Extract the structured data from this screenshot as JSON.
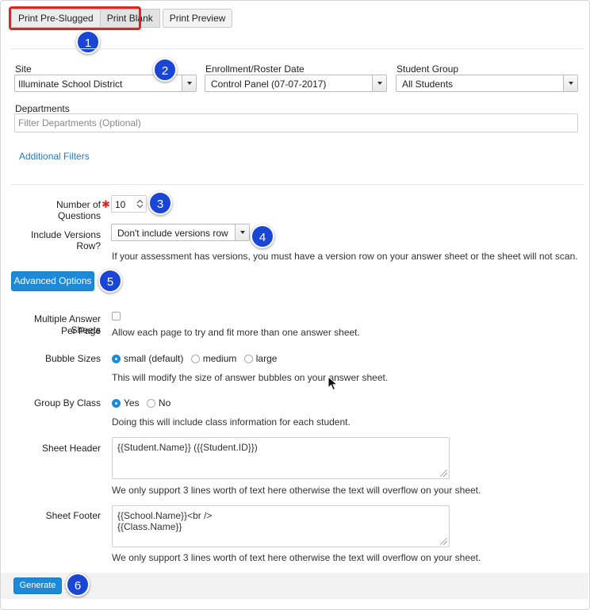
{
  "tabs": {
    "print_pre_slugged": "Print Pre-Slugged",
    "print_blank": "Print Blank",
    "print_preview": "Print Preview"
  },
  "badges": [
    "1",
    "2",
    "3",
    "4",
    "5",
    "6"
  ],
  "filters": {
    "site_label": "Site",
    "site_value": "Illuminate School District",
    "enrollment_label": "Enrollment/Roster Date",
    "enrollment_value": "Control Panel (07-07-2017)",
    "student_group_label": "Student Group",
    "student_group_value": "All Students",
    "departments_label": "Departments",
    "departments_placeholder": "Filter Departments (Optional)",
    "additional_filters": "Additional Filters"
  },
  "form": {
    "num_questions_label": "Number of Questions",
    "num_questions_required": "✱",
    "num_questions_value": "10",
    "versions_label": "Include Versions Row?",
    "versions_value": "Don't include versions row",
    "versions_help": "If your assessment has versions, you must have a version row on your answer sheet or the sheet will not scan.",
    "advanced_options": "Advanced Options",
    "multiple_label_1": "Multiple Answer Sheets",
    "multiple_label_2": "Per Page",
    "multiple_help": "Allow each page to try and fit more than one answer sheet.",
    "bubble_label": "Bubble Sizes",
    "bubble_options": [
      "small (default)",
      "medium",
      "large"
    ],
    "bubble_selected": "small (default)",
    "bubble_help": "This will modify the size of answer bubbles on your answer sheet.",
    "group_label": "Group By Class",
    "group_options": [
      "Yes",
      "No"
    ],
    "group_selected": "Yes",
    "group_help": "Doing this will include class information for each student.",
    "header_label": "Sheet Header",
    "header_value": "{{Student.Name}} ({{Student.ID}})",
    "header_help": "We only support 3 lines worth of text here otherwise the text will overflow on your sheet.",
    "footer_label": "Sheet Footer",
    "footer_value": "{{School.Name}}<br />\n{{Class.Name}}",
    "footer_help": "We only support 3 lines worth of text here otherwise the text will overflow on your sheet.",
    "generate": "Generate"
  },
  "colors": {
    "badge": "#1a46d6",
    "highlight": "#e02424",
    "primary_button": "#1c8ad8",
    "link": "#1f7bc4"
  }
}
